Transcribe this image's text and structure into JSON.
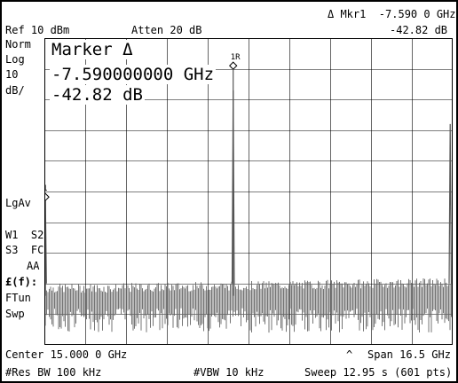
{
  "header": {
    "ref_level": "Ref 10 dBm",
    "atten": "Atten 20 dB",
    "marker_readout_freq": "Δ Mkr1  -7.590 0 GHz",
    "marker_readout_amp": "-42.82 dB"
  },
  "left_panel": {
    "norm": "Norm",
    "log": "Log",
    "scale_value": "10",
    "scale_unit": "dB/",
    "lgav": "LgAv",
    "w1_s2": "W1  S2",
    "s3_fc": "S3  FC",
    "aa": "AA",
    "fx": "£(f):",
    "ftun": "FTun",
    "swp": "Swp"
  },
  "marker_box": {
    "title": "Marker Δ",
    "freq": "-7.590000000 GHz",
    "amp": "-42.82 dB"
  },
  "markers": [
    {
      "label": "1",
      "freq_ghz": 6.79,
      "level_dbm": -41.8
    },
    {
      "label": "1R",
      "freq_ghz": 14.38,
      "level_dbm": 1.0
    }
  ],
  "footer": {
    "center": "Center 15.000 0 GHz",
    "caret": "^",
    "span": "Span 16.5 GHz",
    "res_bw": "#Res BW 100 kHz",
    "vbw": "#VBW 10 kHz",
    "sweep": "Sweep 12.95 s (601 pts)"
  },
  "chart_data": {
    "type": "line",
    "center_ghz": 15.0,
    "span_ghz": 16.5,
    "ref_level_dbm": 10,
    "scale_db_per_div": 10,
    "divisions": 10,
    "ylim": [
      -90,
      10
    ],
    "noise_floor_dbm": [
      -82,
      -70
    ],
    "peaks": [
      {
        "freq_ghz": 6.79,
        "level_dbm": -41.8
      },
      {
        "freq_ghz": 14.38,
        "level_dbm": -7.0
      },
      {
        "freq_ghz": 23.15,
        "level_dbm": -18.0
      }
    ],
    "grid": true
  }
}
